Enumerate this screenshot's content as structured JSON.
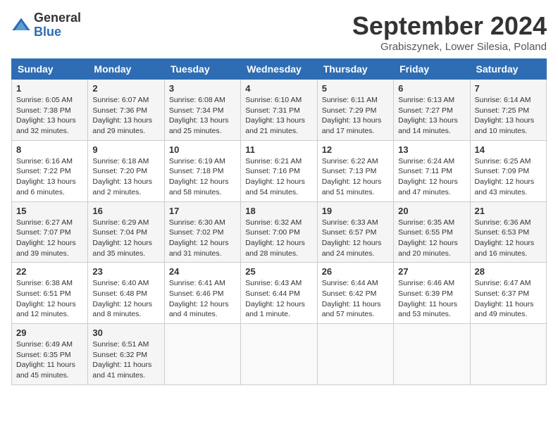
{
  "header": {
    "logo_general": "General",
    "logo_blue": "Blue",
    "month_title": "September 2024",
    "location": "Grabiszynek, Lower Silesia, Poland"
  },
  "days_of_week": [
    "Sunday",
    "Monday",
    "Tuesday",
    "Wednesday",
    "Thursday",
    "Friday",
    "Saturday"
  ],
  "weeks": [
    [
      {
        "day": "1",
        "info": "Sunrise: 6:05 AM\nSunset: 7:38 PM\nDaylight: 13 hours\nand 32 minutes."
      },
      {
        "day": "2",
        "info": "Sunrise: 6:07 AM\nSunset: 7:36 PM\nDaylight: 13 hours\nand 29 minutes."
      },
      {
        "day": "3",
        "info": "Sunrise: 6:08 AM\nSunset: 7:34 PM\nDaylight: 13 hours\nand 25 minutes."
      },
      {
        "day": "4",
        "info": "Sunrise: 6:10 AM\nSunset: 7:31 PM\nDaylight: 13 hours\nand 21 minutes."
      },
      {
        "day": "5",
        "info": "Sunrise: 6:11 AM\nSunset: 7:29 PM\nDaylight: 13 hours\nand 17 minutes."
      },
      {
        "day": "6",
        "info": "Sunrise: 6:13 AM\nSunset: 7:27 PM\nDaylight: 13 hours\nand 14 minutes."
      },
      {
        "day": "7",
        "info": "Sunrise: 6:14 AM\nSunset: 7:25 PM\nDaylight: 13 hours\nand 10 minutes."
      }
    ],
    [
      {
        "day": "8",
        "info": "Sunrise: 6:16 AM\nSunset: 7:22 PM\nDaylight: 13 hours\nand 6 minutes."
      },
      {
        "day": "9",
        "info": "Sunrise: 6:18 AM\nSunset: 7:20 PM\nDaylight: 13 hours\nand 2 minutes."
      },
      {
        "day": "10",
        "info": "Sunrise: 6:19 AM\nSunset: 7:18 PM\nDaylight: 12 hours\nand 58 minutes."
      },
      {
        "day": "11",
        "info": "Sunrise: 6:21 AM\nSunset: 7:16 PM\nDaylight: 12 hours\nand 54 minutes."
      },
      {
        "day": "12",
        "info": "Sunrise: 6:22 AM\nSunset: 7:13 PM\nDaylight: 12 hours\nand 51 minutes."
      },
      {
        "day": "13",
        "info": "Sunrise: 6:24 AM\nSunset: 7:11 PM\nDaylight: 12 hours\nand 47 minutes."
      },
      {
        "day": "14",
        "info": "Sunrise: 6:25 AM\nSunset: 7:09 PM\nDaylight: 12 hours\nand 43 minutes."
      }
    ],
    [
      {
        "day": "15",
        "info": "Sunrise: 6:27 AM\nSunset: 7:07 PM\nDaylight: 12 hours\nand 39 minutes."
      },
      {
        "day": "16",
        "info": "Sunrise: 6:29 AM\nSunset: 7:04 PM\nDaylight: 12 hours\nand 35 minutes."
      },
      {
        "day": "17",
        "info": "Sunrise: 6:30 AM\nSunset: 7:02 PM\nDaylight: 12 hours\nand 31 minutes."
      },
      {
        "day": "18",
        "info": "Sunrise: 6:32 AM\nSunset: 7:00 PM\nDaylight: 12 hours\nand 28 minutes."
      },
      {
        "day": "19",
        "info": "Sunrise: 6:33 AM\nSunset: 6:57 PM\nDaylight: 12 hours\nand 24 minutes."
      },
      {
        "day": "20",
        "info": "Sunrise: 6:35 AM\nSunset: 6:55 PM\nDaylight: 12 hours\nand 20 minutes."
      },
      {
        "day": "21",
        "info": "Sunrise: 6:36 AM\nSunset: 6:53 PM\nDaylight: 12 hours\nand 16 minutes."
      }
    ],
    [
      {
        "day": "22",
        "info": "Sunrise: 6:38 AM\nSunset: 6:51 PM\nDaylight: 12 hours\nand 12 minutes."
      },
      {
        "day": "23",
        "info": "Sunrise: 6:40 AM\nSunset: 6:48 PM\nDaylight: 12 hours\nand 8 minutes."
      },
      {
        "day": "24",
        "info": "Sunrise: 6:41 AM\nSunset: 6:46 PM\nDaylight: 12 hours\nand 4 minutes."
      },
      {
        "day": "25",
        "info": "Sunrise: 6:43 AM\nSunset: 6:44 PM\nDaylight: 12 hours\nand 1 minute."
      },
      {
        "day": "26",
        "info": "Sunrise: 6:44 AM\nSunset: 6:42 PM\nDaylight: 11 hours\nand 57 minutes."
      },
      {
        "day": "27",
        "info": "Sunrise: 6:46 AM\nSunset: 6:39 PM\nDaylight: 11 hours\nand 53 minutes."
      },
      {
        "day": "28",
        "info": "Sunrise: 6:47 AM\nSunset: 6:37 PM\nDaylight: 11 hours\nand 49 minutes."
      }
    ],
    [
      {
        "day": "29",
        "info": "Sunrise: 6:49 AM\nSunset: 6:35 PM\nDaylight: 11 hours\nand 45 minutes."
      },
      {
        "day": "30",
        "info": "Sunrise: 6:51 AM\nSunset: 6:32 PM\nDaylight: 11 hours\nand 41 minutes."
      },
      {
        "day": "",
        "info": ""
      },
      {
        "day": "",
        "info": ""
      },
      {
        "day": "",
        "info": ""
      },
      {
        "day": "",
        "info": ""
      },
      {
        "day": "",
        "info": ""
      }
    ]
  ]
}
